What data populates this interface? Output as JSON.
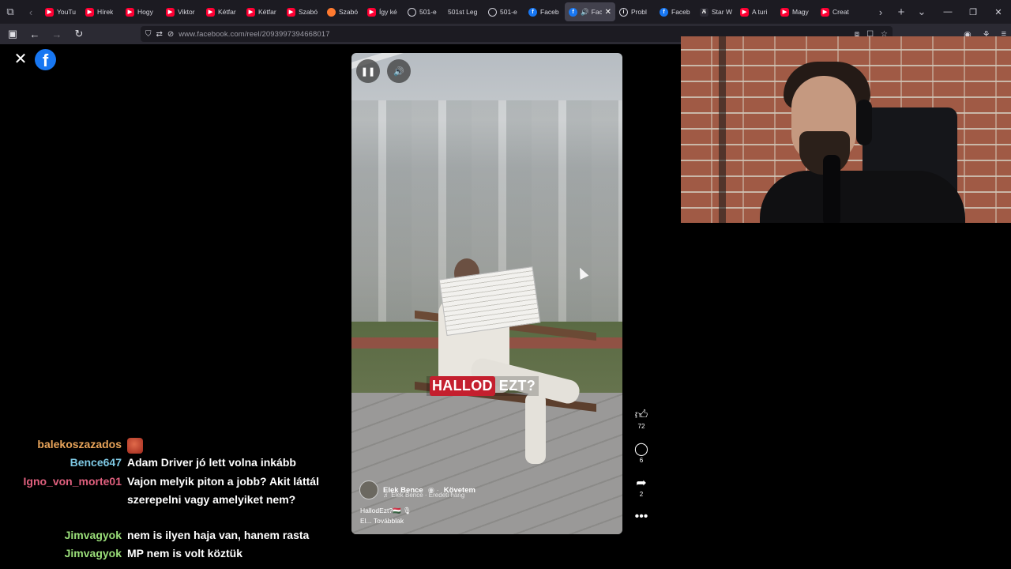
{
  "browser": {
    "tabs": [
      {
        "title": "YouTu",
        "favicon": "youtube-icon"
      },
      {
        "title": "Hírek",
        "favicon": "youtube-icon"
      },
      {
        "title": "Hogy",
        "favicon": "youtube-icon"
      },
      {
        "title": "Viktor",
        "favicon": "youtube-icon"
      },
      {
        "title": "Kétfar",
        "favicon": "youtube-icon"
      },
      {
        "title": "Kétfar",
        "favicon": "youtube-icon"
      },
      {
        "title": "Szabó",
        "favicon": "youtube-icon"
      },
      {
        "title": "Szabó",
        "favicon": "moon-icon"
      },
      {
        "title": "Így ké",
        "favicon": "youtube-icon"
      },
      {
        "title": "501-e",
        "favicon": "globe-icon"
      },
      {
        "title": "501st Leg",
        "favicon": "none"
      },
      {
        "title": "501-e",
        "favicon": "globe-icon"
      },
      {
        "title": "Faceb",
        "favicon": "facebook-icon"
      },
      {
        "title": "Fac",
        "favicon": "facebook-icon",
        "active": true
      },
      {
        "title": "Probl",
        "favicon": "info-icon"
      },
      {
        "title": "Faceb",
        "favicon": "facebook-icon"
      },
      {
        "title": "Star W",
        "favicon": "starwars-icon"
      },
      {
        "title": "A turi",
        "favicon": "youtube-icon"
      },
      {
        "title": "Magy",
        "favicon": "youtube-icon"
      },
      {
        "title": "Creat",
        "favicon": "youtube-icon"
      }
    ],
    "url": "www.facebook.com/reel/2093997394668017"
  },
  "reel": {
    "caption_highlight": "HALLOD",
    "caption_rest": "EZT?",
    "author": "Elek Bence",
    "follow_label": "Követem",
    "audio": "♬ Elek Bence · Eredeti hang",
    "description": "HallodEzt?🇭🇺 🎙",
    "more": "El... Továbblak",
    "likes": "72",
    "comments": "6",
    "shares": "2"
  },
  "chat": [
    {
      "user": "balekoszazados",
      "color": "#e8a45a",
      "text": ""
    },
    {
      "user": "Bence647",
      "color": "#7ec8e3",
      "text": "Adam Driver jó lett volna inkább"
    },
    {
      "user": "Igno_von_morte01",
      "color": "#e0607e",
      "text": "Vajon melyik piton a jobb? Akit láttál szerepelni vagy amelyiket nem?"
    },
    {
      "user": "Jimvagyok",
      "color": "#9be07a",
      "text": "nem is ilyen haja van, hanem rasta"
    },
    {
      "user": "Jimvagyok",
      "color": "#9be07a",
      "text": "MP nem is volt köztük"
    }
  ],
  "colors": {
    "accent_facebook": "#1877f2",
    "caption_highlight": "#c41f2e"
  }
}
